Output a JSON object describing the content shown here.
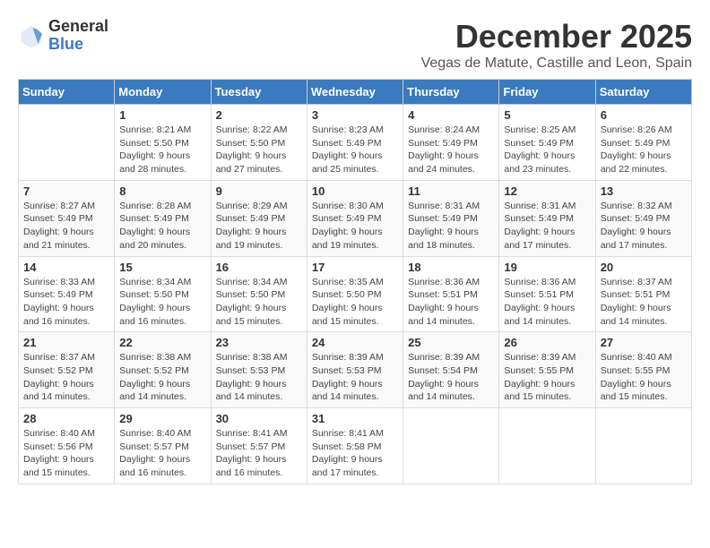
{
  "header": {
    "logo_general": "General",
    "logo_blue": "Blue",
    "month_title": "December 2025",
    "location": "Vegas de Matute, Castille and Leon, Spain"
  },
  "weekdays": [
    "Sunday",
    "Monday",
    "Tuesday",
    "Wednesday",
    "Thursday",
    "Friday",
    "Saturday"
  ],
  "weeks": [
    [
      {
        "day": "",
        "info": ""
      },
      {
        "day": "1",
        "info": "Sunrise: 8:21 AM\nSunset: 5:50 PM\nDaylight: 9 hours\nand 28 minutes."
      },
      {
        "day": "2",
        "info": "Sunrise: 8:22 AM\nSunset: 5:50 PM\nDaylight: 9 hours\nand 27 minutes."
      },
      {
        "day": "3",
        "info": "Sunrise: 8:23 AM\nSunset: 5:49 PM\nDaylight: 9 hours\nand 25 minutes."
      },
      {
        "day": "4",
        "info": "Sunrise: 8:24 AM\nSunset: 5:49 PM\nDaylight: 9 hours\nand 24 minutes."
      },
      {
        "day": "5",
        "info": "Sunrise: 8:25 AM\nSunset: 5:49 PM\nDaylight: 9 hours\nand 23 minutes."
      },
      {
        "day": "6",
        "info": "Sunrise: 8:26 AM\nSunset: 5:49 PM\nDaylight: 9 hours\nand 22 minutes."
      }
    ],
    [
      {
        "day": "7",
        "info": "Sunrise: 8:27 AM\nSunset: 5:49 PM\nDaylight: 9 hours\nand 21 minutes."
      },
      {
        "day": "8",
        "info": "Sunrise: 8:28 AM\nSunset: 5:49 PM\nDaylight: 9 hours\nand 20 minutes."
      },
      {
        "day": "9",
        "info": "Sunrise: 8:29 AM\nSunset: 5:49 PM\nDaylight: 9 hours\nand 19 minutes."
      },
      {
        "day": "10",
        "info": "Sunrise: 8:30 AM\nSunset: 5:49 PM\nDaylight: 9 hours\nand 19 minutes."
      },
      {
        "day": "11",
        "info": "Sunrise: 8:31 AM\nSunset: 5:49 PM\nDaylight: 9 hours\nand 18 minutes."
      },
      {
        "day": "12",
        "info": "Sunrise: 8:31 AM\nSunset: 5:49 PM\nDaylight: 9 hours\nand 17 minutes."
      },
      {
        "day": "13",
        "info": "Sunrise: 8:32 AM\nSunset: 5:49 PM\nDaylight: 9 hours\nand 17 minutes."
      }
    ],
    [
      {
        "day": "14",
        "info": "Sunrise: 8:33 AM\nSunset: 5:49 PM\nDaylight: 9 hours\nand 16 minutes."
      },
      {
        "day": "15",
        "info": "Sunrise: 8:34 AM\nSunset: 5:50 PM\nDaylight: 9 hours\nand 16 minutes."
      },
      {
        "day": "16",
        "info": "Sunrise: 8:34 AM\nSunset: 5:50 PM\nDaylight: 9 hours\nand 15 minutes."
      },
      {
        "day": "17",
        "info": "Sunrise: 8:35 AM\nSunset: 5:50 PM\nDaylight: 9 hours\nand 15 minutes."
      },
      {
        "day": "18",
        "info": "Sunrise: 8:36 AM\nSunset: 5:51 PM\nDaylight: 9 hours\nand 14 minutes."
      },
      {
        "day": "19",
        "info": "Sunrise: 8:36 AM\nSunset: 5:51 PM\nDaylight: 9 hours\nand 14 minutes."
      },
      {
        "day": "20",
        "info": "Sunrise: 8:37 AM\nSunset: 5:51 PM\nDaylight: 9 hours\nand 14 minutes."
      }
    ],
    [
      {
        "day": "21",
        "info": "Sunrise: 8:37 AM\nSunset: 5:52 PM\nDaylight: 9 hours\nand 14 minutes."
      },
      {
        "day": "22",
        "info": "Sunrise: 8:38 AM\nSunset: 5:52 PM\nDaylight: 9 hours\nand 14 minutes."
      },
      {
        "day": "23",
        "info": "Sunrise: 8:38 AM\nSunset: 5:53 PM\nDaylight: 9 hours\nand 14 minutes."
      },
      {
        "day": "24",
        "info": "Sunrise: 8:39 AM\nSunset: 5:53 PM\nDaylight: 9 hours\nand 14 minutes."
      },
      {
        "day": "25",
        "info": "Sunrise: 8:39 AM\nSunset: 5:54 PM\nDaylight: 9 hours\nand 14 minutes."
      },
      {
        "day": "26",
        "info": "Sunrise: 8:39 AM\nSunset: 5:55 PM\nDaylight: 9 hours\nand 15 minutes."
      },
      {
        "day": "27",
        "info": "Sunrise: 8:40 AM\nSunset: 5:55 PM\nDaylight: 9 hours\nand 15 minutes."
      }
    ],
    [
      {
        "day": "28",
        "info": "Sunrise: 8:40 AM\nSunset: 5:56 PM\nDaylight: 9 hours\nand 15 minutes."
      },
      {
        "day": "29",
        "info": "Sunrise: 8:40 AM\nSunset: 5:57 PM\nDaylight: 9 hours\nand 16 minutes."
      },
      {
        "day": "30",
        "info": "Sunrise: 8:41 AM\nSunset: 5:57 PM\nDaylight: 9 hours\nand 16 minutes."
      },
      {
        "day": "31",
        "info": "Sunrise: 8:41 AM\nSunset: 5:58 PM\nDaylight: 9 hours\nand 17 minutes."
      },
      {
        "day": "",
        "info": ""
      },
      {
        "day": "",
        "info": ""
      },
      {
        "day": "",
        "info": ""
      }
    ]
  ]
}
